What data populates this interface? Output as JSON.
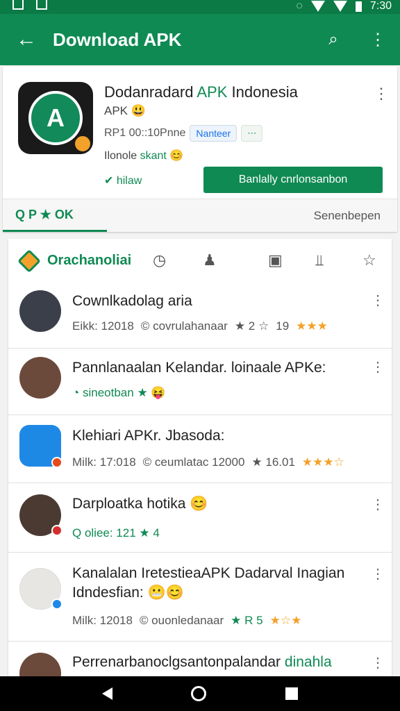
{
  "status": {
    "time": "7:30"
  },
  "appbar": {
    "title": "Download APK",
    "back_icon": "←",
    "search_icon": "⌕",
    "more_icon": "⋮"
  },
  "header": {
    "icon_glyph": "A",
    "app_name": "Dodanradard",
    "app_name_green": "APK",
    "app_name_tail": "Indonesia",
    "sub": "APK 😃",
    "meta": "RP1 00::10Pnne",
    "chip1": "Nanteer",
    "chip2": "⋯",
    "line3_a": "Ilonole",
    "line3_b": "skant 😊",
    "link": "✔ hilaw",
    "button": "Banlally cnrlonsanbon",
    "more": "⋮"
  },
  "tabs": {
    "active": "Q P ★ OK",
    "other": "Senenbepen"
  },
  "list": {
    "header_label": "Orachanoliai",
    "header_icons": [
      "◷",
      "♟",
      "▣",
      "⫫",
      "☆"
    ],
    "items": [
      {
        "title": "Cownlkadolag aria",
        "meta_a": "Eikk: 12018",
        "meta_b": "© covrulahanaar",
        "meta_c": "★ 2 ☆",
        "meta_d": "19",
        "stars": "★★★"
      },
      {
        "title": "Pannlanaalan Kelandar. loinaale APKe:",
        "meta_a": "",
        "meta_b": "◔ sineotban ★ 😝",
        "meta_c": "",
        "meta_d": "",
        "stars": ""
      },
      {
        "title": "Klehiari APKr. Jbasoda:",
        "meta_a": "Milk: 17:018",
        "meta_b": "© ceumlatac 12000",
        "meta_c": "★ 16.01",
        "meta_d": "",
        "stars": "★★★☆"
      },
      {
        "title": "Darploatka hotika 😊",
        "meta_a": "",
        "meta_b": "Q oliee: 121 ★ 4",
        "meta_c": "",
        "meta_d": "",
        "stars": ""
      },
      {
        "title": "Kanalalan IretestieaAPK Dadarval Inagian",
        "title2": "Idndesfian: 😬😊",
        "meta_a": "Milk: 12018",
        "meta_b": "© ouonledanaar",
        "meta_c": "★ R 5",
        "meta_d": "",
        "stars": "★☆★"
      },
      {
        "title": "Perrenarbanoclgsantonpalandar",
        "title_green": "dinahla",
        "meta_a": "",
        "meta_b": "",
        "meta_c": "",
        "meta_d": "",
        "stars": ""
      }
    ],
    "more_icon": "⋮"
  },
  "colors": {
    "brand": "#0f8a53",
    "status": "#0b7a45",
    "star": "#f2a12a"
  }
}
